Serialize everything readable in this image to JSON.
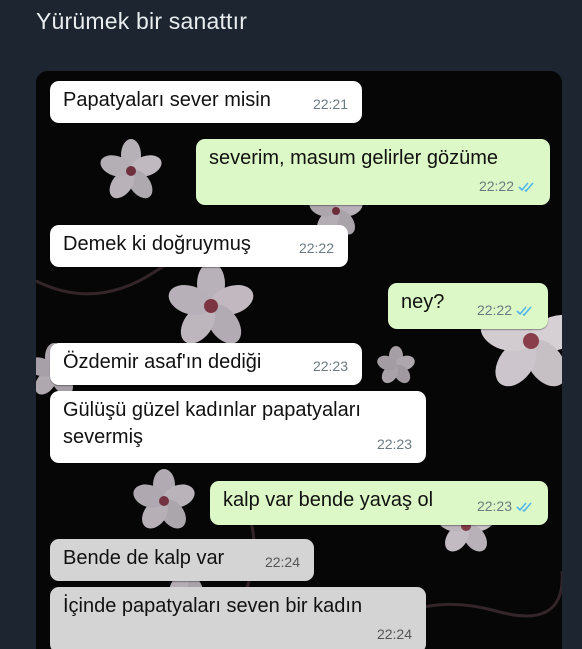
{
  "header": {
    "title": "Yürümek bir sanattır"
  },
  "messages": [
    {
      "text": "Papatyaları sever misin",
      "time": "22:21",
      "dir": "in"
    },
    {
      "text": "severim, masum gelirler gözüme",
      "time": "22:22",
      "dir": "out",
      "read": true
    },
    {
      "text": "Demek ki doğruymuş",
      "time": "22:22",
      "dir": "in"
    },
    {
      "text": "ney?",
      "time": "22:22",
      "dir": "out",
      "read": true
    },
    {
      "text": "Özdemir asaf'ın dediği",
      "time": "22:23",
      "dir": "in"
    },
    {
      "text_line1": "Gülüşü güzel kadınlar papatyaları",
      "text_line2": "severmiş",
      "time": "22:23",
      "dir": "in"
    },
    {
      "text": "kalp var bende yavaş ol",
      "time": "22:23",
      "dir": "out",
      "read": true
    },
    {
      "text": "Bende de kalp var",
      "time": "22:24",
      "dir": "in"
    },
    {
      "text": "İçinde papatyaları seven bir kadın",
      "time": "22:24",
      "dir": "in"
    }
  ],
  "colors": {
    "incoming": "#ffffff",
    "outgoing": "#dcf8c6",
    "read_tick": "#4fb6ec"
  },
  "icons": {
    "read_receipt": "double-check-icon"
  }
}
